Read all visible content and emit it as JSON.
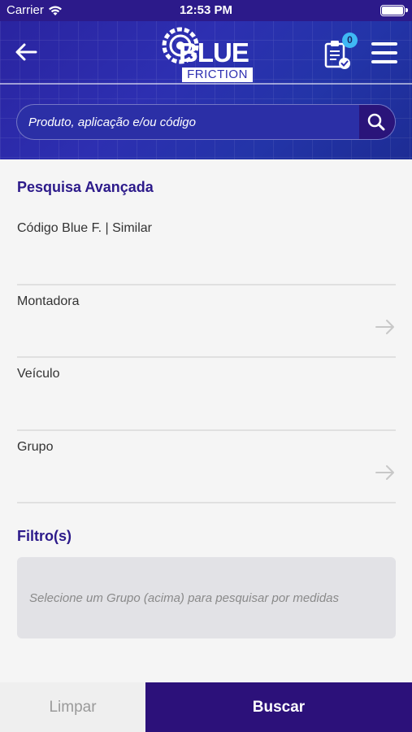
{
  "status_bar": {
    "carrier": "Carrier",
    "time": "12:53 PM"
  },
  "header": {
    "logo_word_1": "BLUE",
    "logo_word_2": "FRICTION",
    "cart_count": "0",
    "icons": [
      "back-arrow-icon",
      "clipboard-check-icon",
      "menu-icon"
    ]
  },
  "search": {
    "placeholder": "Produto, aplicação e/ou código"
  },
  "advanced": {
    "title": "Pesquisa Avançada",
    "fields": [
      {
        "label": "Código Blue F. | Similar"
      },
      {
        "label": "Montadora"
      },
      {
        "label": "Veículo"
      },
      {
        "label": "Grupo"
      }
    ]
  },
  "filters": {
    "title": "Filtro(s)",
    "hint": "Selecione um Grupo (acima) para pesquisar por medidas"
  },
  "actions": {
    "clear": "Limpar",
    "search": "Buscar"
  },
  "colors": {
    "primary": "#2c117a",
    "header_blue": "#2d2fb1",
    "badge": "#3fb8f4"
  }
}
